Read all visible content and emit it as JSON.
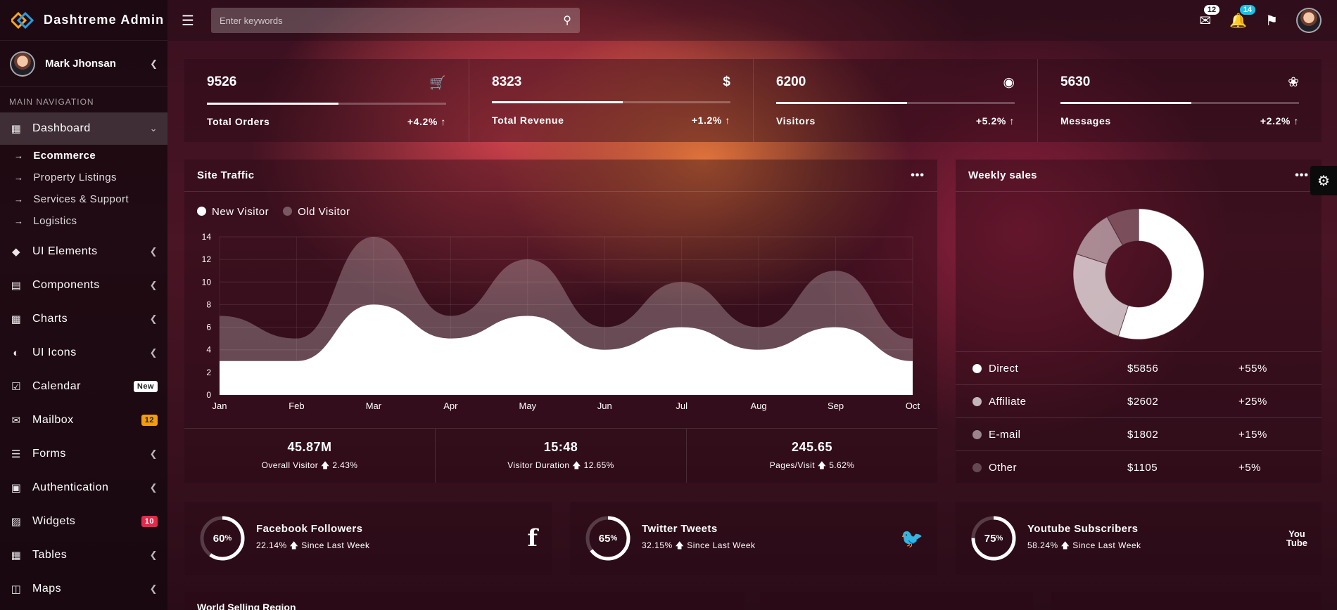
{
  "brand": {
    "name": "Dashtreme Admin"
  },
  "user": {
    "name": "Mark Jhonsan"
  },
  "nav": {
    "header": "MAIN NAVIGATION",
    "dashboard": "Dashboard",
    "sub": [
      "Ecommerce",
      "Property Listings",
      "Services & Support",
      "Logistics"
    ],
    "items": [
      {
        "label": "UI Elements"
      },
      {
        "label": "Components"
      },
      {
        "label": "Charts"
      },
      {
        "label": "UI Icons"
      },
      {
        "label": "Calendar",
        "badge": "New"
      },
      {
        "label": "Mailbox",
        "badge": "12"
      },
      {
        "label": "Forms"
      },
      {
        "label": "Authentication"
      },
      {
        "label": "Widgets",
        "badge": "10"
      },
      {
        "label": "Tables"
      },
      {
        "label": "Maps"
      }
    ]
  },
  "search": {
    "placeholder": "Enter keywords"
  },
  "topbar": {
    "mail_count": "12",
    "notif_count": "14"
  },
  "stats": [
    {
      "value": "9526",
      "label": "Total Orders",
      "change": "+4.2% ↑",
      "progress": 0.55
    },
    {
      "value": "8323",
      "label": "Total Revenue",
      "change": "+1.2% ↑",
      "progress": 0.55
    },
    {
      "value": "6200",
      "label": "Visitors",
      "change": "+5.2% ↑",
      "progress": 0.55
    },
    {
      "value": "5630",
      "label": "Messages",
      "change": "+2.2% ↑",
      "progress": 0.55
    }
  ],
  "traffic": {
    "title": "Site Traffic",
    "legend": [
      "New Visitor",
      "Old Visitor"
    ],
    "footer": [
      {
        "value": "45.87M",
        "label": "Overall Visitor",
        "change": "2.43%"
      },
      {
        "value": "15:48",
        "label": "Visitor Duration",
        "change": "12.65%"
      },
      {
        "value": "245.65",
        "label": "Pages/Visit",
        "change": "5.62%"
      }
    ]
  },
  "chart_data": {
    "type": "area",
    "x": [
      "Jan",
      "Feb",
      "Mar",
      "Apr",
      "May",
      "Jun",
      "Jul",
      "Aug",
      "Sep",
      "Oct"
    ],
    "series": [
      {
        "name": "New Visitor",
        "values": [
          3,
          3,
          8,
          5,
          7,
          4,
          6,
          4,
          6,
          3
        ],
        "color": "#ffffff"
      },
      {
        "name": "Old Visitor",
        "values": [
          7,
          5,
          14,
          7,
          12,
          6,
          10,
          6,
          11,
          5
        ],
        "color": "rgba(255,255,255,0.25)"
      }
    ],
    "yticks": [
      "0",
      "2",
      "4",
      "6",
      "8",
      "10",
      "12",
      "14"
    ],
    "ylim": [
      0,
      14
    ]
  },
  "weekly": {
    "title": "Weekly sales",
    "rows": [
      {
        "name": "Direct",
        "amount": "$5856",
        "change": "+55%",
        "color": "#ffffff",
        "share": 0.55
      },
      {
        "name": "Affiliate",
        "amount": "$2602",
        "change": "+25%",
        "color": "rgba(255,255,255,0.7)",
        "share": 0.25
      },
      {
        "name": "E-mail",
        "amount": "$1802",
        "change": "+15%",
        "color": "rgba(255,255,255,0.5)",
        "share": 0.12
      },
      {
        "name": "Other",
        "amount": "$1105",
        "change": "+5%",
        "color": "rgba(255,255,255,0.25)",
        "share": 0.08
      }
    ]
  },
  "social": [
    {
      "pct": "60",
      "title": "Facebook Followers",
      "sub": "22.14%",
      "since": "Since Last Week",
      "icon": "f"
    },
    {
      "pct": "65",
      "title": "Twitter Tweets",
      "sub": "32.15%",
      "since": "Since Last Week",
      "icon": "🐦"
    },
    {
      "pct": "75",
      "title": "Youtube Subscribers",
      "sub": "58.24%",
      "since": "Since Last Week",
      "icon": "You\nTube"
    }
  ],
  "bottom": {
    "partial_title": "World Selling Region"
  }
}
